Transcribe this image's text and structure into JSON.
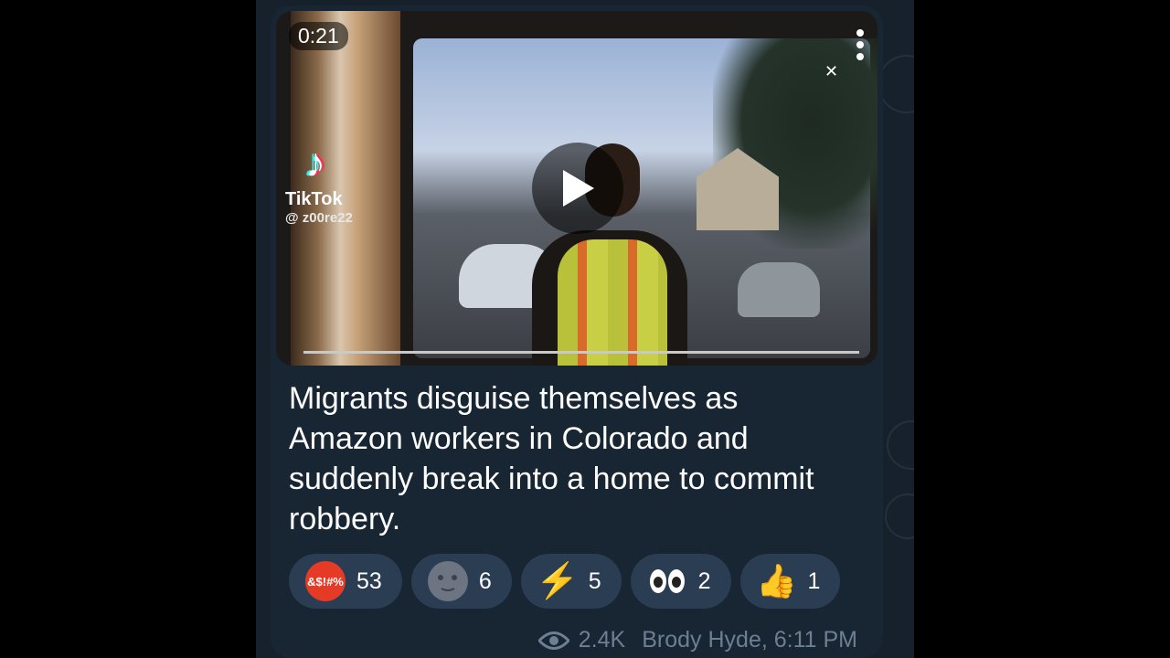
{
  "video": {
    "duration": "0:21",
    "watermark_brand": "TikTok",
    "watermark_handle": "@ z00re22"
  },
  "message": {
    "caption": "Migrants disguise themselves as Amazon workers in Colorado and suddenly break into a home to commit robbery.",
    "views": "2.4K",
    "author_time": "Brody Hyde, 6:11 PM"
  },
  "reactions": [
    {
      "emoji": "angry-face-with-symbols",
      "count": "53"
    },
    {
      "emoji": "new-moon-face",
      "count": "6"
    },
    {
      "emoji": "high-voltage",
      "count": "5"
    },
    {
      "emoji": "eyes",
      "count": "2"
    },
    {
      "emoji": "thumbs-up",
      "count": "1"
    }
  ],
  "colors": {
    "chat_background": "#17212b",
    "bubble": "#182533",
    "reaction_pill": "#2b3d52",
    "meta_text": "#6d7f93"
  }
}
